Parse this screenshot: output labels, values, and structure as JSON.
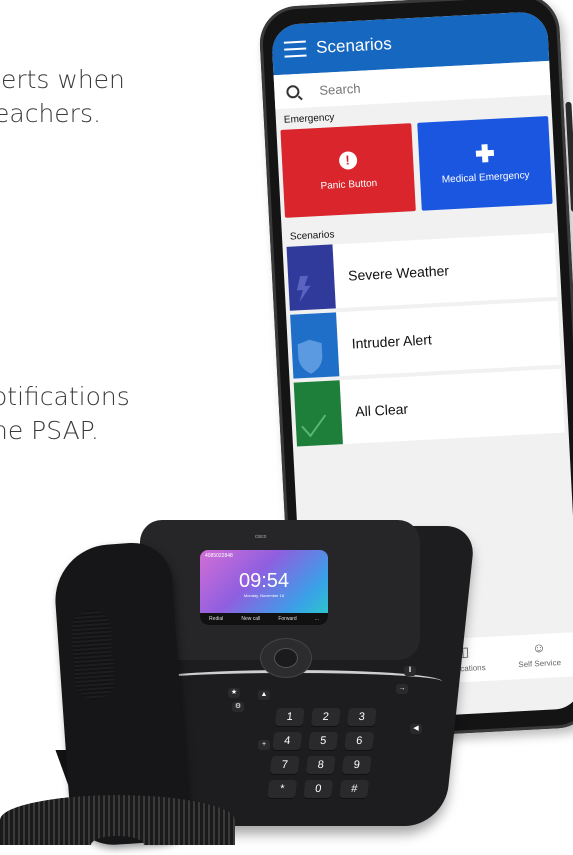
{
  "copy": {
    "line1": "lerts when",
    "line2": "eachers.",
    "line3": "otifications",
    "line4": "he PSAP."
  },
  "app": {
    "title": "Scenarios",
    "search_placeholder": "Search",
    "emergency_label": "Emergency",
    "emergency_tiles": [
      {
        "label": "Panic Button",
        "color": "#d9252b",
        "icon": "alert-icon"
      },
      {
        "label": "Medical Emergency",
        "color": "#1a56e0",
        "icon": "medical-cross-icon"
      }
    ],
    "scenarios_label": "Scenarios",
    "scenarios": [
      {
        "label": "Severe Weather",
        "color": "#2f3a9a",
        "icon": "lightning-icon"
      },
      {
        "label": "Intruder Alert",
        "color": "#1f6fc8",
        "icon": "shield-icon"
      },
      {
        "label": "All Clear",
        "color": "#1d7f3a",
        "icon": "checkmark-icon"
      }
    ],
    "bottom_nav": [
      {
        "label": "Notifications",
        "icon": "inbox-icon"
      },
      {
        "label": "Self Service",
        "icon": "person-icon"
      }
    ],
    "accent": "#1667c0"
  },
  "deskphone": {
    "brand": "cisco",
    "display": {
      "number": "4085022848",
      "time": "09:54",
      "date": "Monday, November 16",
      "softkeys": [
        "Redial",
        "New call",
        "Forward",
        "..."
      ]
    },
    "keys": [
      "1",
      "2",
      "3",
      "4",
      "5",
      "6",
      "7",
      "8",
      "9",
      "*",
      "0",
      "#"
    ]
  }
}
